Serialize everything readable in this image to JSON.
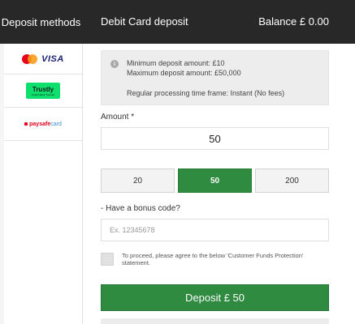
{
  "sidebar": {
    "header": "Deposit methods",
    "methods": [
      {
        "id": "card",
        "label": "VISA",
        "icons": [
          "mastercard-icon",
          "visa-icon"
        ],
        "active": true
      },
      {
        "id": "trustly",
        "label": "Trustly",
        "sublabel": "Instant Bank Transfer",
        "icons": [
          "trustly-icon"
        ]
      },
      {
        "id": "paysafecard",
        "label_parts": [
          "pay",
          "safe",
          "card"
        ],
        "icons": [
          "paysafecard-icon"
        ]
      }
    ]
  },
  "header": {
    "title": "Debit Card deposit",
    "balance": "Balance £ 0.00"
  },
  "info": {
    "min": "Minimum deposit amount: £10",
    "max": "Maximum deposit amount: £50,000",
    "processing": "Regular processing time frame: Instant (No fees)"
  },
  "amount": {
    "label": "Amount *",
    "value": "50",
    "presets": [
      "20",
      "50",
      "200"
    ],
    "selected_preset": "50"
  },
  "bonus": {
    "label": "- Have a bonus code?",
    "placeholder": "Ex. 12345678"
  },
  "agreement": {
    "text": "To proceed, please agree to the below 'Customer Funds Protection' statement.",
    "checked": false
  },
  "deposit_button": "Deposit £ 50",
  "colors": {
    "header_bg": "#282828",
    "accent_green": "#2e8b3f",
    "trustly_green": "#0ee06e"
  }
}
